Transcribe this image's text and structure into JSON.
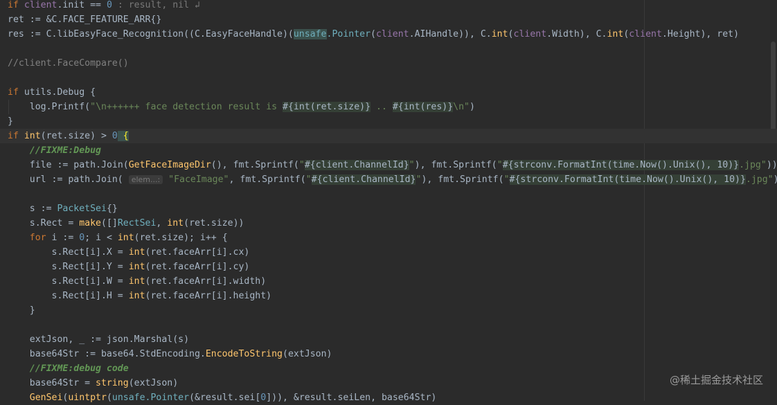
{
  "code": {
    "l1": {
      "a": "if ",
      "b": "client",
      "c": ".init == ",
      "d": "0",
      "e": " : result, nil ↲"
    },
    "l2": {
      "a": "ret := &C.FACE_FEATURE_ARR{}"
    },
    "l3": {
      "a": "res := C.libEasyFace_Recognition((C.EasyFaceHandle)(",
      "b": "unsafe",
      "c": ".Pointer",
      "d": "(",
      "e": "client",
      "f": ".AIHandle)), C.",
      "g": "int",
      "h": "(",
      "i": "client",
      "j": ".Width), C.",
      "k": "int",
      "l": "(",
      "m": "client",
      "n": ".Height), ret)"
    },
    "l5": {
      "a": "//client.FaceCompare()"
    },
    "l7": {
      "a": "if ",
      "b": "utils",
      "c": ".Debug {"
    },
    "l8": {
      "a": "log",
      "b": ".Printf(",
      "c": "\"\\n++++++ face detection result is ",
      "d": "#{int(ret.size)}",
      "e": " .. ",
      "f": "#{int(res)}",
      "g": "\\n\"",
      "h": ")"
    },
    "l9": {
      "a": "}"
    },
    "l10": {
      "a": "if ",
      "b": "int",
      "c": "(ret.size) > ",
      "d": "0",
      "e": " {"
    },
    "l11": {
      "a": "//FIXME:Debug"
    },
    "l12": {
      "a": "file := ",
      "b": "path",
      "c": ".Join(",
      "d": "GetFaceImageDir",
      "e": "(), ",
      "f": "fmt",
      "g": ".Sprintf(",
      "h": "\"",
      "i": "#{client.ChannelId}",
      "j": "\"",
      "k": "), ",
      "l": "fmt",
      "m": ".Sprintf(",
      "n": "\"",
      "o": "#{strconv.FormatInt(time.Now().Unix(), 10)}",
      "p": ".jpg\"",
      "q": "))"
    },
    "l13": {
      "a": "url := ",
      "b": "path",
      "c": ".Join( ",
      "hint": "elem...:",
      "d": " \"FaceImage\"",
      "e": ", ",
      "f": "fmt",
      "g": ".Sprintf(",
      "h": "\"",
      "i": "#{client.ChannelId}",
      "j": "\"",
      "k": "), ",
      "l": "fmt",
      "m": ".Sprintf(",
      "n": "\"",
      "o": "#{strconv.FormatInt(time.Now().Unix(), 10)}",
      "p": ".jpg\"",
      "q": "))"
    },
    "l15": {
      "a": "s := ",
      "b": "PacketSei",
      "c": "{}"
    },
    "l16": {
      "a": "s.Rect = ",
      "b": "make",
      "c": "([]",
      "d": "RectSei",
      "e": ", ",
      "f": "int",
      "g": "(ret.size))"
    },
    "l17": {
      "a": "for ",
      "b": "i := ",
      "c": "0",
      "d": "; i < ",
      "e": "int",
      "f": "(ret.size); i++ {"
    },
    "l18": {
      "a": "s.Rect[i].X = ",
      "b": "int",
      "c": "(ret.faceArr[i].cx)"
    },
    "l19": {
      "a": "s.Rect[i].Y = ",
      "b": "int",
      "c": "(ret.faceArr[i].cy)"
    },
    "l20": {
      "a": "s.Rect[i].W = ",
      "b": "int",
      "c": "(ret.faceArr[i].width)"
    },
    "l21": {
      "a": "s.Rect[i].H = ",
      "b": "int",
      "c": "(ret.faceArr[i].height)"
    },
    "l22": {
      "a": "}"
    },
    "l24": {
      "a": "extJson, _ := ",
      "b": "json",
      "c": ".Marshal(s)"
    },
    "l25": {
      "a": "base64Str := ",
      "b": "base64",
      "c": ".StdEncoding.",
      "d": "EncodeToString",
      "e": "(extJson)"
    },
    "l26": {
      "a": "//FIXME:debug code"
    },
    "l27": {
      "a": "base64Str = ",
      "b": "string",
      "c": "(extJson)"
    },
    "l28": {
      "a": "GenSei",
      "b": "(",
      "c": "uintptr",
      "d": "(",
      "e": "unsafe",
      "f": ".Pointer",
      "g": "(&result.sei[",
      "h": "0",
      "i": "])), &result.seiLen, base64Str)"
    }
  },
  "watermark": "@稀土掘金技术社区",
  "colors": {
    "background": "#2b2b2b",
    "keyword": "#cc7832",
    "number": "#6897bb",
    "string": "#6a8759",
    "function": "#ffc66d",
    "comment": "#808080",
    "todo": "#629755"
  }
}
